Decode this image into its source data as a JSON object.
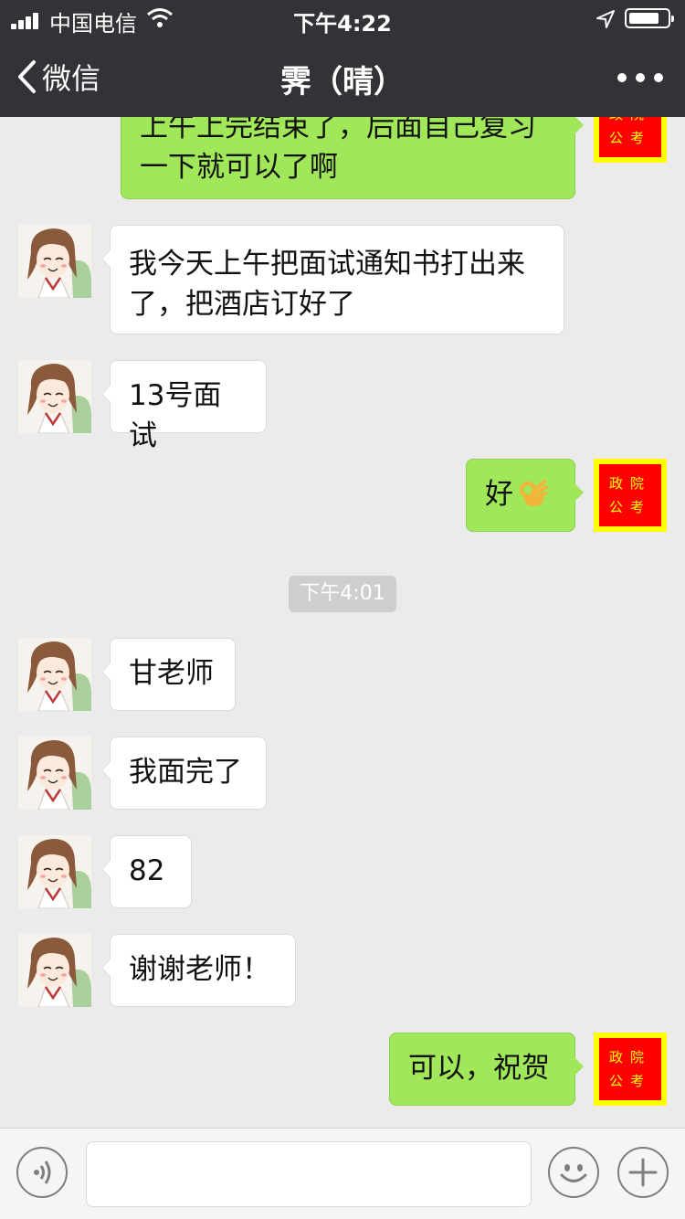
{
  "status": {
    "carrier": "中国电信",
    "time": "下午4:22"
  },
  "nav": {
    "back_label": "微信",
    "title": "霁（晴）"
  },
  "self_avatar": {
    "line1": "政院",
    "line2": "公考",
    "bg": "#ff0000",
    "border": "#ffff00",
    "text_color": "#ffff00"
  },
  "colors": {
    "sent_bubble": "#a0e75a",
    "received_bubble": "#ffffff",
    "chat_bg": "#ebebeb",
    "nav_bg": "#333337"
  },
  "messages": [
    {
      "side": "right",
      "text": "上午上完结束了，后面自己复习一下就可以了啊"
    },
    {
      "side": "left",
      "text": "我今天上午把面试通知书打出来了，把酒店订好了"
    },
    {
      "side": "left",
      "text": "13号面试"
    },
    {
      "side": "right",
      "text": "好",
      "emoji": "ok-hand-icon"
    },
    {
      "side": "left",
      "text": "甘老师"
    },
    {
      "side": "left",
      "text": "我面完了"
    },
    {
      "side": "left",
      "text": "82"
    },
    {
      "side": "left",
      "text": "谢谢老师！"
    },
    {
      "side": "right",
      "text": "可以，祝贺"
    }
  ],
  "timestamp": "下午4:01",
  "input_bar": {
    "voice_icon": "voice-icon",
    "emoji_icon": "smiley-icon",
    "plus_icon": "plus-icon",
    "text_value": ""
  }
}
